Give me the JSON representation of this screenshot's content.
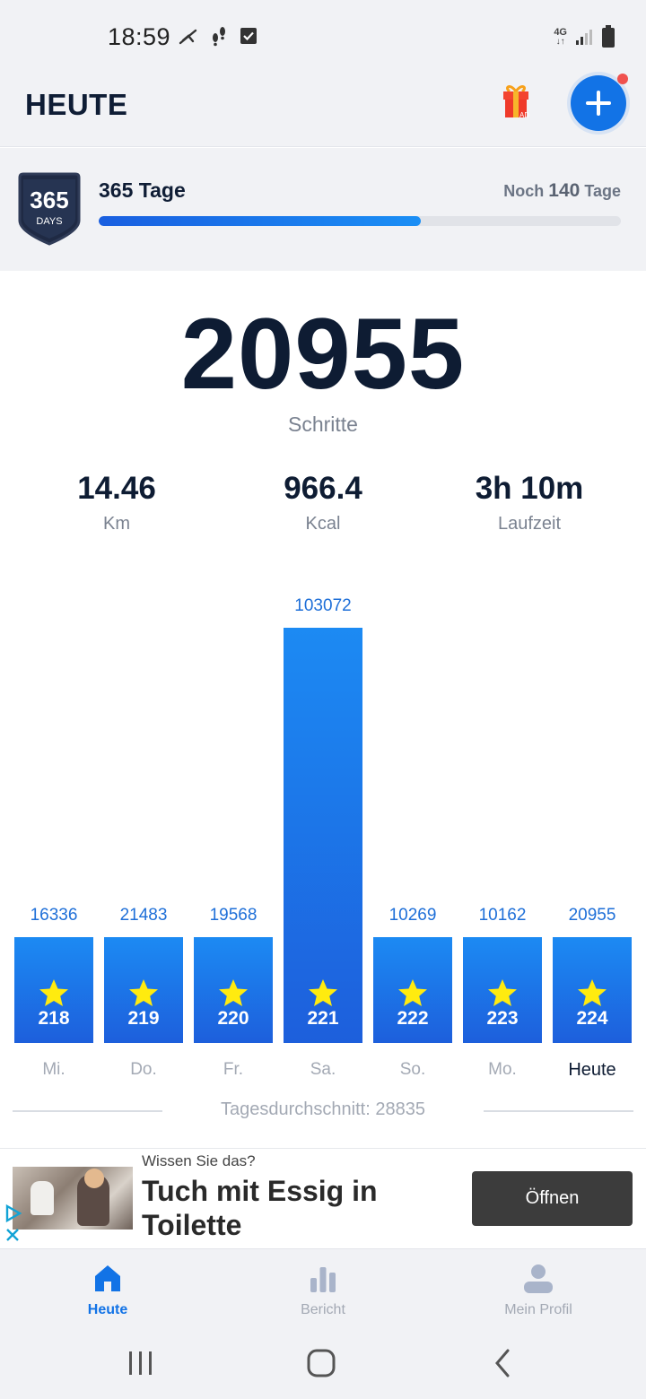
{
  "status_bar": {
    "time": "18:59",
    "left_icons": [
      "pin-icon",
      "footsteps-icon",
      "check-icon"
    ],
    "network": "4G",
    "right_icons": [
      "signal-icon",
      "battery-icon"
    ]
  },
  "header": {
    "title": "HEUTE",
    "gift_icon": "gift-icon",
    "gift_badge": "AD",
    "add_icon": "plus-icon",
    "colors": {
      "accent": "#1273e6",
      "notification_dot": "#f0524f"
    }
  },
  "challenge": {
    "badge_number": "365",
    "badge_caption": "DAYS",
    "title": "365 Tage",
    "remaining_prefix": "Noch",
    "remaining_days": "140",
    "remaining_suffix": "Tage",
    "progress": 0.616
  },
  "today": {
    "steps": "20955",
    "steps_label": "Schritte",
    "stats": [
      {
        "value": "14.46",
        "label": "Km"
      },
      {
        "value": "966.4",
        "label": "Kcal"
      },
      {
        "value": "3h 10m",
        "label": "Laufzeit"
      }
    ]
  },
  "chart_data": {
    "type": "bar",
    "categories": [
      "Mi.",
      "Do.",
      "Fr.",
      "Sa.",
      "So.",
      "Mo.",
      "Heute"
    ],
    "values": [
      16336,
      21483,
      19568,
      103072,
      10269,
      10162,
      20955
    ],
    "star_counts": [
      "218",
      "219",
      "220",
      "221",
      "222",
      "223",
      "224"
    ],
    "average_label": "Tagesdurchschnitt: 28835",
    "colors": {
      "bar_top": "#1c8af3",
      "bar_bottom": "#1d5fdc",
      "star": "#ffeb0f",
      "value_label": "#1e6fd8"
    }
  },
  "ad": {
    "kicker": "Wissen Sie das?",
    "headline": "Tuch mit Essig in Toilette",
    "cta": "Öffnen"
  },
  "bottom_nav": {
    "items": [
      {
        "label": "Heute",
        "icon": "home-icon",
        "active": true
      },
      {
        "label": "Bericht",
        "icon": "bar-chart-icon",
        "active": false
      },
      {
        "label": "Mein Profil",
        "icon": "profile-icon",
        "active": false
      }
    ]
  },
  "system_nav": [
    "recent-apps-icon",
    "home-button-icon",
    "back-icon"
  ]
}
